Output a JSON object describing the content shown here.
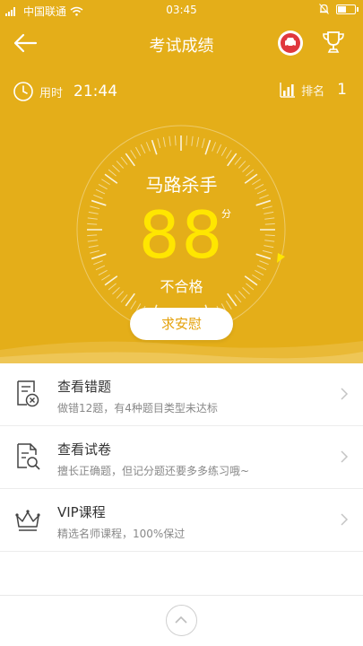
{
  "status_bar": {
    "carrier": "中国联通",
    "time": "03:45"
  },
  "header": {
    "title": "考试成绩"
  },
  "stats": {
    "time_label": "用时",
    "time_value": "21:44",
    "rank_label": "排名",
    "rank_value": "1"
  },
  "result": {
    "nickname": "马路杀手",
    "score": "88",
    "score_unit": "分",
    "status": "不合格",
    "action_label": "求安慰"
  },
  "colors": {
    "hero": "#e4ae19",
    "score": "#ffe600",
    "button_text": "#e4a10b",
    "car_icon": "#e0383e"
  },
  "menu": {
    "items": [
      {
        "title": "查看错题",
        "desc": "做错12题，有4种题目类型未达标",
        "icon": "wrong-questions-icon"
      },
      {
        "title": "查看试卷",
        "desc": "擅长正确题，但记分题还要多多练习哦~",
        "icon": "exam-paper-icon"
      },
      {
        "title": "VIP课程",
        "desc": "精选名师课程，100%保过",
        "icon": "crown-icon"
      }
    ]
  }
}
